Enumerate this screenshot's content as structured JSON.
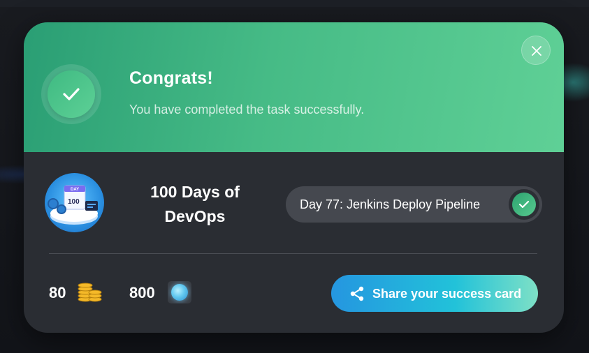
{
  "header": {
    "title": "Congrats!",
    "subtitle": "You have completed the task successfully."
  },
  "course": {
    "title": "100 Days of DevOps",
    "logo_text": "100",
    "logo_tag": "DAY"
  },
  "task": {
    "label": "Day 77: Jenkins Deploy Pipeline",
    "completed": true
  },
  "rewards": {
    "coins": "80",
    "gems": "800"
  },
  "share": {
    "label": "Share your success card"
  },
  "icons": {
    "success": "check-icon",
    "close": "close-icon",
    "task_done": "check-icon",
    "coins": "coins-icon",
    "gems": "gem-icon",
    "share": "share-icon"
  },
  "colors": {
    "header_start": "#2a9e74",
    "header_end": "#5fd096",
    "panel": "#2a2d33",
    "pill": "#45484f",
    "share_start": "#2596e0",
    "share_end": "#7ee0c6"
  }
}
